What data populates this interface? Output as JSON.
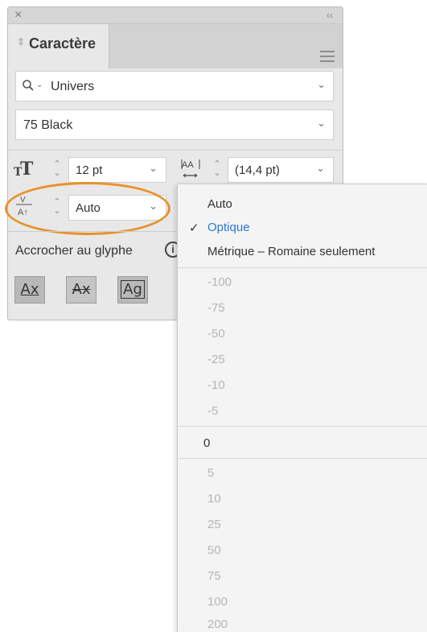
{
  "panel": {
    "close_glyph": "×",
    "collapse_glyph": "‹‹",
    "tab_arrows": "⇕",
    "tab_label": "Caractère",
    "font_family": "Univers",
    "font_style": "75 Black",
    "font_size": "12 pt",
    "leading": "(14,4 pt)",
    "kerning": "Auto",
    "snap_label": "Accrocher au glyphe",
    "info_glyph": "i",
    "buttons": [
      "Ax",
      "Ax",
      "Ag"
    ]
  },
  "dropdown": {
    "items": [
      {
        "label": "Auto",
        "state": "normal"
      },
      {
        "label": "Optique",
        "state": "selected"
      },
      {
        "label": "Métrique – Romaine seulement",
        "state": "normal"
      },
      {
        "label": "-100",
        "state": "disabled"
      },
      {
        "label": "-75",
        "state": "disabled"
      },
      {
        "label": "-50",
        "state": "disabled"
      },
      {
        "label": "-25",
        "state": "disabled"
      },
      {
        "label": "-10",
        "state": "disabled"
      },
      {
        "label": "-5",
        "state": "disabled"
      },
      {
        "label": "0",
        "state": "normal"
      },
      {
        "label": "5",
        "state": "disabled"
      },
      {
        "label": "10",
        "state": "disabled"
      },
      {
        "label": "25",
        "state": "disabled"
      },
      {
        "label": "50",
        "state": "disabled"
      },
      {
        "label": "75",
        "state": "disabled"
      },
      {
        "label": "100",
        "state": "disabled"
      },
      {
        "label": "200",
        "state": "disabled"
      }
    ],
    "check_glyph": "✓"
  },
  "colors": {
    "highlight": "#e8922a",
    "selected_text": "#2878d6"
  }
}
